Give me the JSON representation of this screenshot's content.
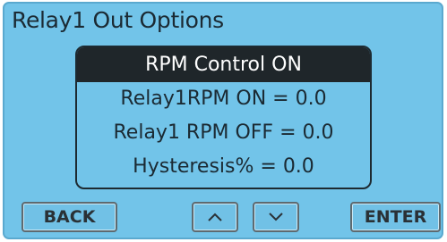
{
  "title": "Relay1 Out Options",
  "panel": {
    "header": "RPM Control ON",
    "rows": [
      "Relay1RPM ON = 0.0",
      "Relay1 RPM OFF = 0.0",
      "Hysteresis% = 0.0"
    ]
  },
  "buttons": {
    "back": "BACK",
    "up_icon": "chevron-up-icon",
    "down_icon": "chevron-down-icon",
    "enter": "ENTER"
  },
  "colors": {
    "screen_bg": "#72c4e9",
    "header_bg": "#1f262a"
  }
}
